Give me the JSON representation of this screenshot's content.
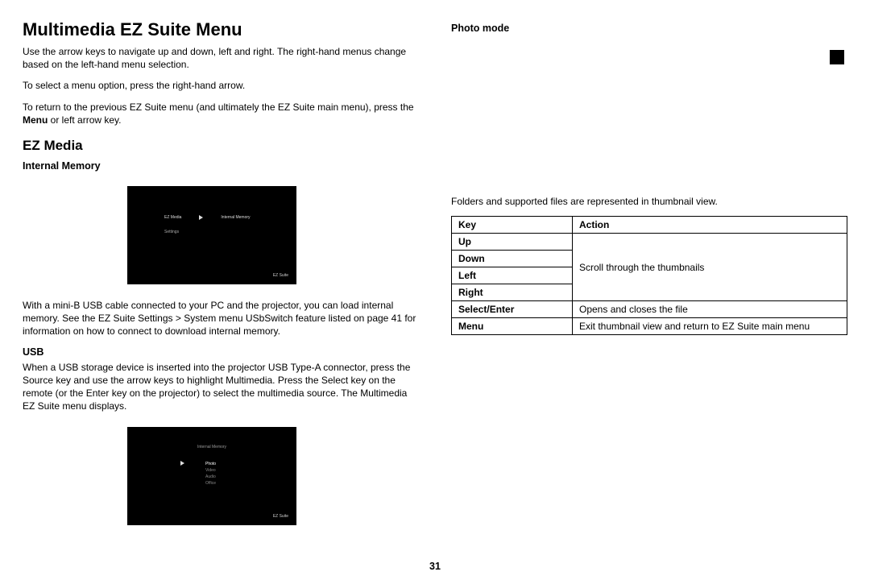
{
  "title": "Multimedia EZ Suite Menu",
  "para1": "Use the arrow keys to navigate up and down, left and right. The right-hand menus change based on the left-hand menu selection.",
  "para2": "To select a menu option, press the right-hand arrow.",
  "para3a": "To return to the previous EZ Suite menu (and ultimately the EZ Suite main menu), press the ",
  "para3b": "Menu",
  "para3c": " or left arrow key.",
  "h2_ezmedia": "EZ Media",
  "h3_internal": "Internal Memory",
  "para4": "With a mini-B USB cable connected to your PC and the projector, you can load internal memory. See the EZ Suite Settings > System menu USbSwitch feature listed on page 41 for information on how to connect to download internal memory.",
  "h3_usb": "USB",
  "para5": "When a USB storage device is inserted into the projector USB Type-A connector, press the Source key and use the arrow keys to highlight Multimedia. Press the Select key on the remote (or the Enter key on the projector) to select the multimedia source. The Multimedia EZ Suite menu displays.",
  "h3_photo": "Photo mode",
  "para6": "Folders and supported files are represented in thumbnail view.",
  "table": {
    "hdr_key": "Key",
    "hdr_action": "Action",
    "k_up": "Up",
    "k_down": "Down",
    "k_left": "Left",
    "k_right": "Right",
    "a_scroll": "Scroll through the thumbnails",
    "k_select": "Select/Enter",
    "a_select": "Opens and closes the file",
    "k_menu": "Menu",
    "a_menu": "Exit thumbnail view and return to EZ Suite main menu"
  },
  "shot1": {
    "left": "EZ Media",
    "right": "Internal Memory",
    "sub": "Settings",
    "br": "EZ Suite"
  },
  "shot2": {
    "top": "Internal Memory",
    "label": "Photo",
    "l1": "Video",
    "l2": "Audio",
    "l3": "Office",
    "br": "EZ Suite"
  },
  "pagenum": "31"
}
